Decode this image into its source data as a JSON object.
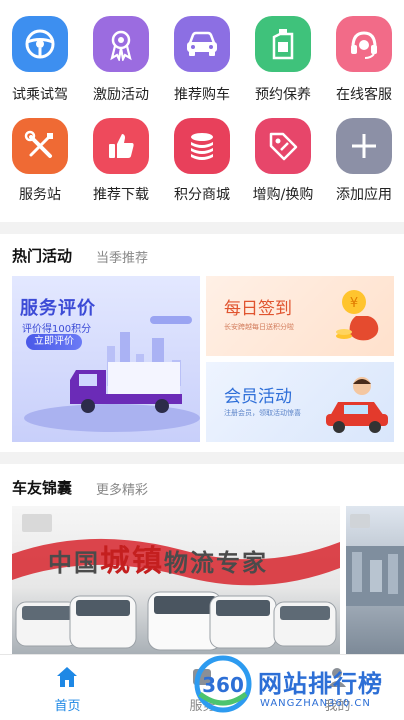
{
  "grid": {
    "items": [
      {
        "label": "试乘试驾",
        "icon": "steering-wheel-icon",
        "color": "#3d8ff0"
      },
      {
        "label": "激励活动",
        "icon": "award-badge-icon",
        "color": "#9b6ce0"
      },
      {
        "label": "推荐购车",
        "icon": "car-icon",
        "color": "#8c6fe3"
      },
      {
        "label": "预约保养",
        "icon": "oil-can-icon",
        "color": "#3fc27b"
      },
      {
        "label": "在线客服",
        "icon": "headset-icon",
        "color": "#f26b88"
      },
      {
        "label": "服务站",
        "icon": "wrench-screwdriver-icon",
        "color": "#ef6a34"
      },
      {
        "label": "推荐下载",
        "icon": "thumbs-up-icon",
        "color": "#ee4a5c"
      },
      {
        "label": "积分商城",
        "icon": "coin-stack-icon",
        "color": "#e8405b"
      },
      {
        "label": "增购/换购",
        "icon": "tag-icon",
        "color": "#e7466a"
      },
      {
        "label": "添加应用",
        "icon": "plus-icon",
        "color": "#8c90a6"
      }
    ]
  },
  "hot": {
    "title": "热门活动",
    "subtitle": "当季推荐",
    "review": {
      "title": "服务评价",
      "sub": "评价得100积分",
      "button": "立即评价"
    },
    "sign": {
      "title": "每日签到",
      "sub": "长安跨越每日送积分啦"
    },
    "member": {
      "title": "会员活动",
      "sub": "注册会员，领取活动惊喜"
    }
  },
  "friends": {
    "title": "车友锦囊",
    "subtitle": "更多精彩",
    "banner_slogan_a": "中国",
    "banner_slogan_b": "城镇",
    "banner_slogan_c": "物流专家"
  },
  "tabs": [
    {
      "label": "首页",
      "icon": "home-icon",
      "active": true
    },
    {
      "label": "服务",
      "icon": "service-icon",
      "active": false
    },
    {
      "label": "我的",
      "icon": "profile-icon",
      "active": false
    }
  ],
  "watermark": {
    "text": "网站排行榜",
    "badge": "360",
    "sub": "WANGZHAN360.CN"
  }
}
